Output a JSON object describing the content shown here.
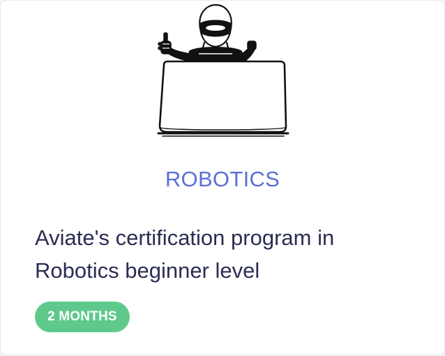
{
  "course": {
    "category": "ROBOTICS",
    "title": "Aviate's certification program in Robotics beginner level",
    "duration": "2 MONTHS"
  },
  "illustration": {
    "icon": "robot-with-laptop-illustration"
  },
  "colors": {
    "category": "#5a6fd6",
    "title": "#2b2d52",
    "badge_bg": "#5ec98b",
    "badge_text": "#ffffff",
    "card_bg": "#ffffff"
  }
}
